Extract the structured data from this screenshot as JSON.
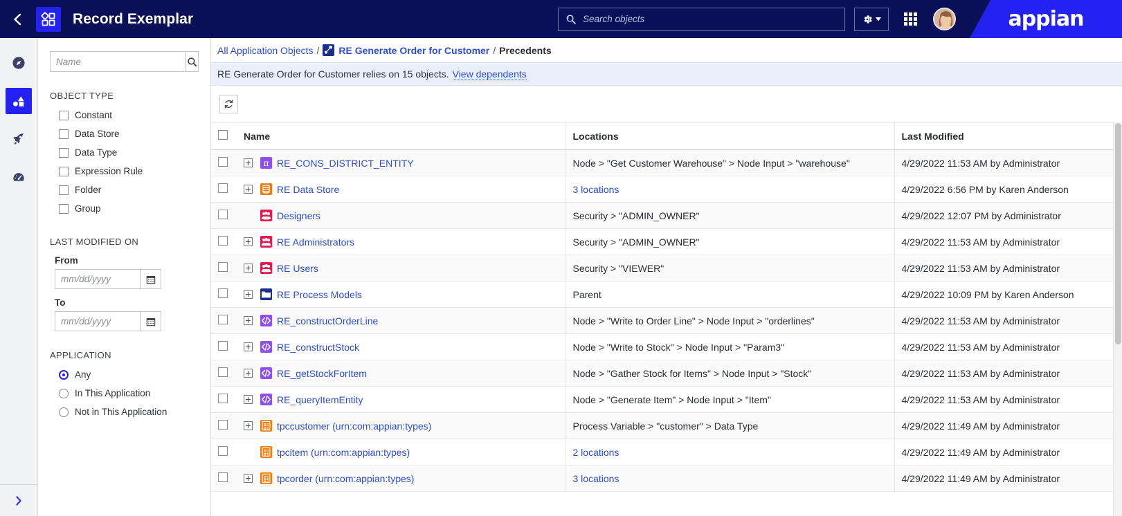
{
  "topbar": {
    "back_icon": "chevron-left-icon",
    "app_icon": "app-shapes-icon",
    "title": "Record Exemplar",
    "search_placeholder": "Search objects",
    "search_value": "",
    "search_icon": "search-objects-icon",
    "gear_icon": "gear-icon",
    "gear_caret_icon": "caret-down-icon",
    "grid_icon": "app-grid-icon",
    "avatar": "user-avatar",
    "brand": "appian",
    "bg_color": "#0b1158",
    "accent_color": "#2322f0"
  },
  "rail": {
    "items": [
      {
        "icon": "compass-icon",
        "active": false
      },
      {
        "icon": "shapes-icon",
        "active": true
      },
      {
        "icon": "rocket-icon",
        "active": false
      },
      {
        "icon": "gauge-icon",
        "active": false
      }
    ],
    "expand_icon": "chevron-right-icon"
  },
  "filters": {
    "name_placeholder": "Name",
    "name_value": "",
    "search_icon": "search-icon",
    "object_type": {
      "title": "OBJECT TYPE",
      "options": [
        {
          "label": "Constant",
          "checked": false
        },
        {
          "label": "Data Store",
          "checked": false
        },
        {
          "label": "Data Type",
          "checked": false
        },
        {
          "label": "Expression Rule",
          "checked": false
        },
        {
          "label": "Folder",
          "checked": false
        },
        {
          "label": "Group",
          "checked": false
        }
      ]
    },
    "last_modified": {
      "title": "LAST MODIFIED ON",
      "from_label": "From",
      "from_placeholder": "mm/dd/yyyy",
      "from_value": "",
      "to_label": "To",
      "to_placeholder": "mm/dd/yyyy",
      "to_value": "",
      "calendar_icon": "calendar-icon"
    },
    "application": {
      "title": "APPLICATION",
      "options": [
        {
          "label": "Any",
          "selected": true
        },
        {
          "label": "In This Application",
          "selected": false
        },
        {
          "label": "Not in This Application",
          "selected": false
        }
      ]
    }
  },
  "breadcrumb": {
    "root": "All Application Objects",
    "sep1": "/",
    "object_icon": "process-model-icon",
    "object": "RE Generate Order for Customer",
    "sep2": "/",
    "current": "Precedents"
  },
  "notice": {
    "text": "RE Generate Order for Customer relies on 15 objects.",
    "link": "View dependents"
  },
  "toolbar": {
    "refresh_icon": "refresh-icon"
  },
  "table": {
    "columns": [
      "Name",
      "Locations",
      "Last Modified"
    ],
    "rows": [
      {
        "expandable": true,
        "icon": "constant-icon",
        "icon_class": "constant",
        "icon_glyph": "π",
        "name": "RE_CONS_DISTRICT_ENTITY",
        "location": "Node > \"Get Customer Warehouse\" > Node Input > \"warehouse\"",
        "location_is_link": false,
        "modified": "4/29/2022 11:53 AM by Administrator"
      },
      {
        "expandable": true,
        "icon": "data-store-icon",
        "icon_class": "datastore",
        "icon_glyph": "⌸",
        "name": "RE Data Store",
        "location": "3 locations",
        "location_is_link": true,
        "modified": "4/29/2022 6:56 PM by Karen Anderson"
      },
      {
        "expandable": false,
        "icon": "group-icon",
        "icon_class": "group",
        "icon_glyph": "\u0000",
        "name": "Designers",
        "location": "Security > \"ADMIN_OWNER\"",
        "location_is_link": false,
        "modified": "4/29/2022 12:07 PM by Administrator"
      },
      {
        "expandable": true,
        "icon": "group-icon",
        "icon_class": "group",
        "icon_glyph": "\u0000",
        "name": "RE Administrators",
        "location": "Security > \"ADMIN_OWNER\"",
        "location_is_link": false,
        "modified": "4/29/2022 11:53 AM by Administrator"
      },
      {
        "expandable": true,
        "icon": "group-icon",
        "icon_class": "group",
        "icon_glyph": "\u0000",
        "name": "RE Users",
        "location": "Security > \"VIEWER\"",
        "location_is_link": false,
        "modified": "4/29/2022 11:53 AM by Administrator"
      },
      {
        "expandable": true,
        "icon": "folder-icon",
        "icon_class": "folder",
        "icon_glyph": "\u0000",
        "name": "RE Process Models",
        "location": "Parent",
        "location_is_link": false,
        "modified": "4/29/2022 10:09 PM by Karen Anderson"
      },
      {
        "expandable": true,
        "icon": "expression-rule-icon",
        "icon_class": "rule",
        "icon_glyph": "</>",
        "name": "RE_constructOrderLine",
        "location": "Node > \"Write to Order Line\" > Node Input > \"orderlines\"",
        "location_is_link": false,
        "modified": "4/29/2022 11:53 AM by Administrator"
      },
      {
        "expandable": true,
        "icon": "expression-rule-icon",
        "icon_class": "rule",
        "icon_glyph": "</>",
        "name": "RE_constructStock",
        "location": "Node > \"Write to Stock\" > Node Input > \"Param3\"",
        "location_is_link": false,
        "modified": "4/29/2022 11:53 AM by Administrator"
      },
      {
        "expandable": true,
        "icon": "expression-rule-icon",
        "icon_class": "rule",
        "icon_glyph": "</>",
        "name": "RE_getStockForItem",
        "location": "Node > \"Gather Stock for Items\" > Node Input > \"Stock\"",
        "location_is_link": false,
        "modified": "4/29/2022 11:53 AM by Administrator"
      },
      {
        "expandable": true,
        "icon": "expression-rule-icon",
        "icon_class": "rule",
        "icon_glyph": "</>",
        "name": "RE_queryItemEntity",
        "location": "Node > \"Generate Item\" > Node Input > \"Item\"",
        "location_is_link": false,
        "modified": "4/29/2022 11:53 AM by Administrator"
      },
      {
        "expandable": true,
        "icon": "data-type-icon",
        "icon_class": "datatype",
        "icon_glyph": "\u0000",
        "name": "tpccustomer (urn:com:appian:types)",
        "location": "Process Variable > \"customer\" > Data Type",
        "location_is_link": false,
        "modified": "4/29/2022 11:49 AM by Administrator"
      },
      {
        "expandable": false,
        "icon": "data-type-icon",
        "icon_class": "datatype",
        "icon_glyph": "\u0000",
        "name": "tpcitem (urn:com:appian:types)",
        "location": "2 locations",
        "location_is_link": true,
        "modified": "4/29/2022 11:49 AM by Administrator"
      },
      {
        "expandable": true,
        "icon": "data-type-icon",
        "icon_class": "datatype",
        "icon_glyph": "\u0000",
        "name": "tpcorder (urn:com:appian:types)",
        "location": "3 locations",
        "location_is_link": true,
        "modified": "4/29/2022 11:49 AM by Administrator"
      }
    ]
  }
}
